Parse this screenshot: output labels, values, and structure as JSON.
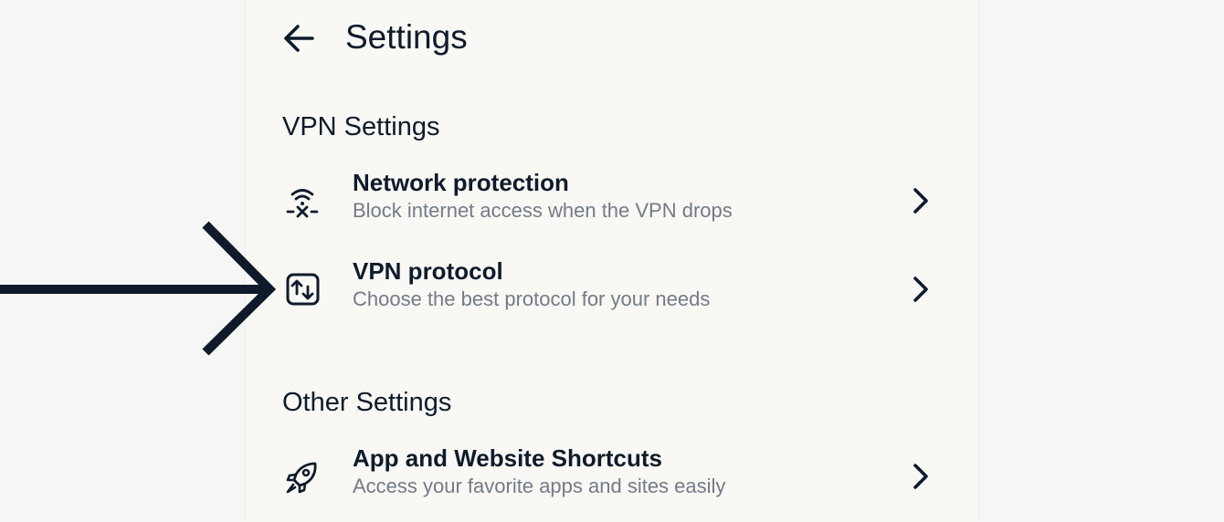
{
  "header": {
    "title": "Settings"
  },
  "sections": [
    {
      "title": "VPN Settings",
      "items": [
        {
          "label": "Network protection",
          "subtitle": "Block internet access when the VPN drops",
          "icon": "network-protection-icon"
        },
        {
          "label": "VPN protocol",
          "subtitle": "Choose the best protocol for your needs",
          "icon": "vpn-protocol-icon"
        }
      ]
    },
    {
      "title": "Other Settings",
      "items": [
        {
          "label": "App and Website Shortcuts",
          "subtitle": "Access your favorite apps and sites easily",
          "icon": "rocket-icon"
        }
      ]
    }
  ],
  "colors": {
    "text": "#0f1b2a",
    "subtext": "#737b86",
    "panel": "#f9f8f5",
    "page": "#f6f6f6",
    "annotation_arrow": "#0f1b2a"
  }
}
